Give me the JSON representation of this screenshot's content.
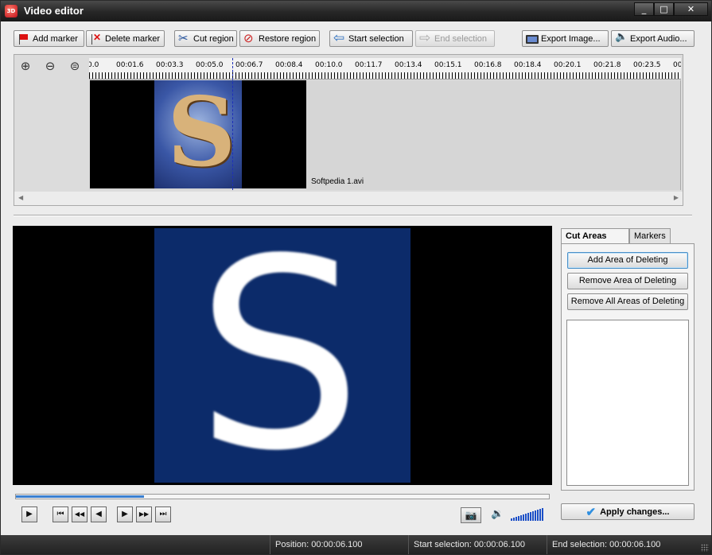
{
  "window": {
    "title": "Video editor",
    "app_icon_text": "3D",
    "controls": {
      "minimize": "_",
      "maximize": "□",
      "close": "✕"
    }
  },
  "toolbar": {
    "add_marker": "Add marker",
    "delete_marker": "Delete marker",
    "cut_region": "Cut region",
    "restore_region": "Restore region",
    "start_selection": "Start selection",
    "end_selection": "End selection",
    "export_image": "Export Image...",
    "export_audio": "Export Audio..."
  },
  "zoom": {
    "zoom_in": "⊕",
    "zoom_out": "⊖",
    "zoom_fit": "⊜"
  },
  "timeline": {
    "ticks": [
      "0.0",
      "00:01.6",
      "00:03.3",
      "00:05.0",
      "00:06.7",
      "00:08.4",
      "00:10.0",
      "00:11.7",
      "00:13.4",
      "00:15.1",
      "00:16.8",
      "00:18.4",
      "00:20.1",
      "00:21.8",
      "00:23.5",
      "00:"
    ],
    "clip_name": "Softpedia 1.avi"
  },
  "tabs": {
    "cut_areas": "Cut Areas",
    "markers": "Markers"
  },
  "side_panel": {
    "add_area": "Add Area of Deleting",
    "remove_area": "Remove Area of Deleting",
    "remove_all": "Remove All Areas of Deleting"
  },
  "playback": {
    "play": "▶",
    "first": "⏮",
    "rewind": "◀◀",
    "step_back": "◀",
    "step_forward": "▶",
    "fast_forward": "▶▶",
    "last": "⏭",
    "seek_fraction": 0.24,
    "volume_level": 1.0
  },
  "apply_button": "Apply changes...",
  "status": {
    "position": "Position: 00:00:06.100",
    "start_selection": "Start selection: 00:00:06.100",
    "end_selection": "End selection: 00:00:06.100"
  },
  "colors": {
    "title_bar": "#262626",
    "accent": "#1b4fc7",
    "status_bar": "#2a2a2a"
  }
}
